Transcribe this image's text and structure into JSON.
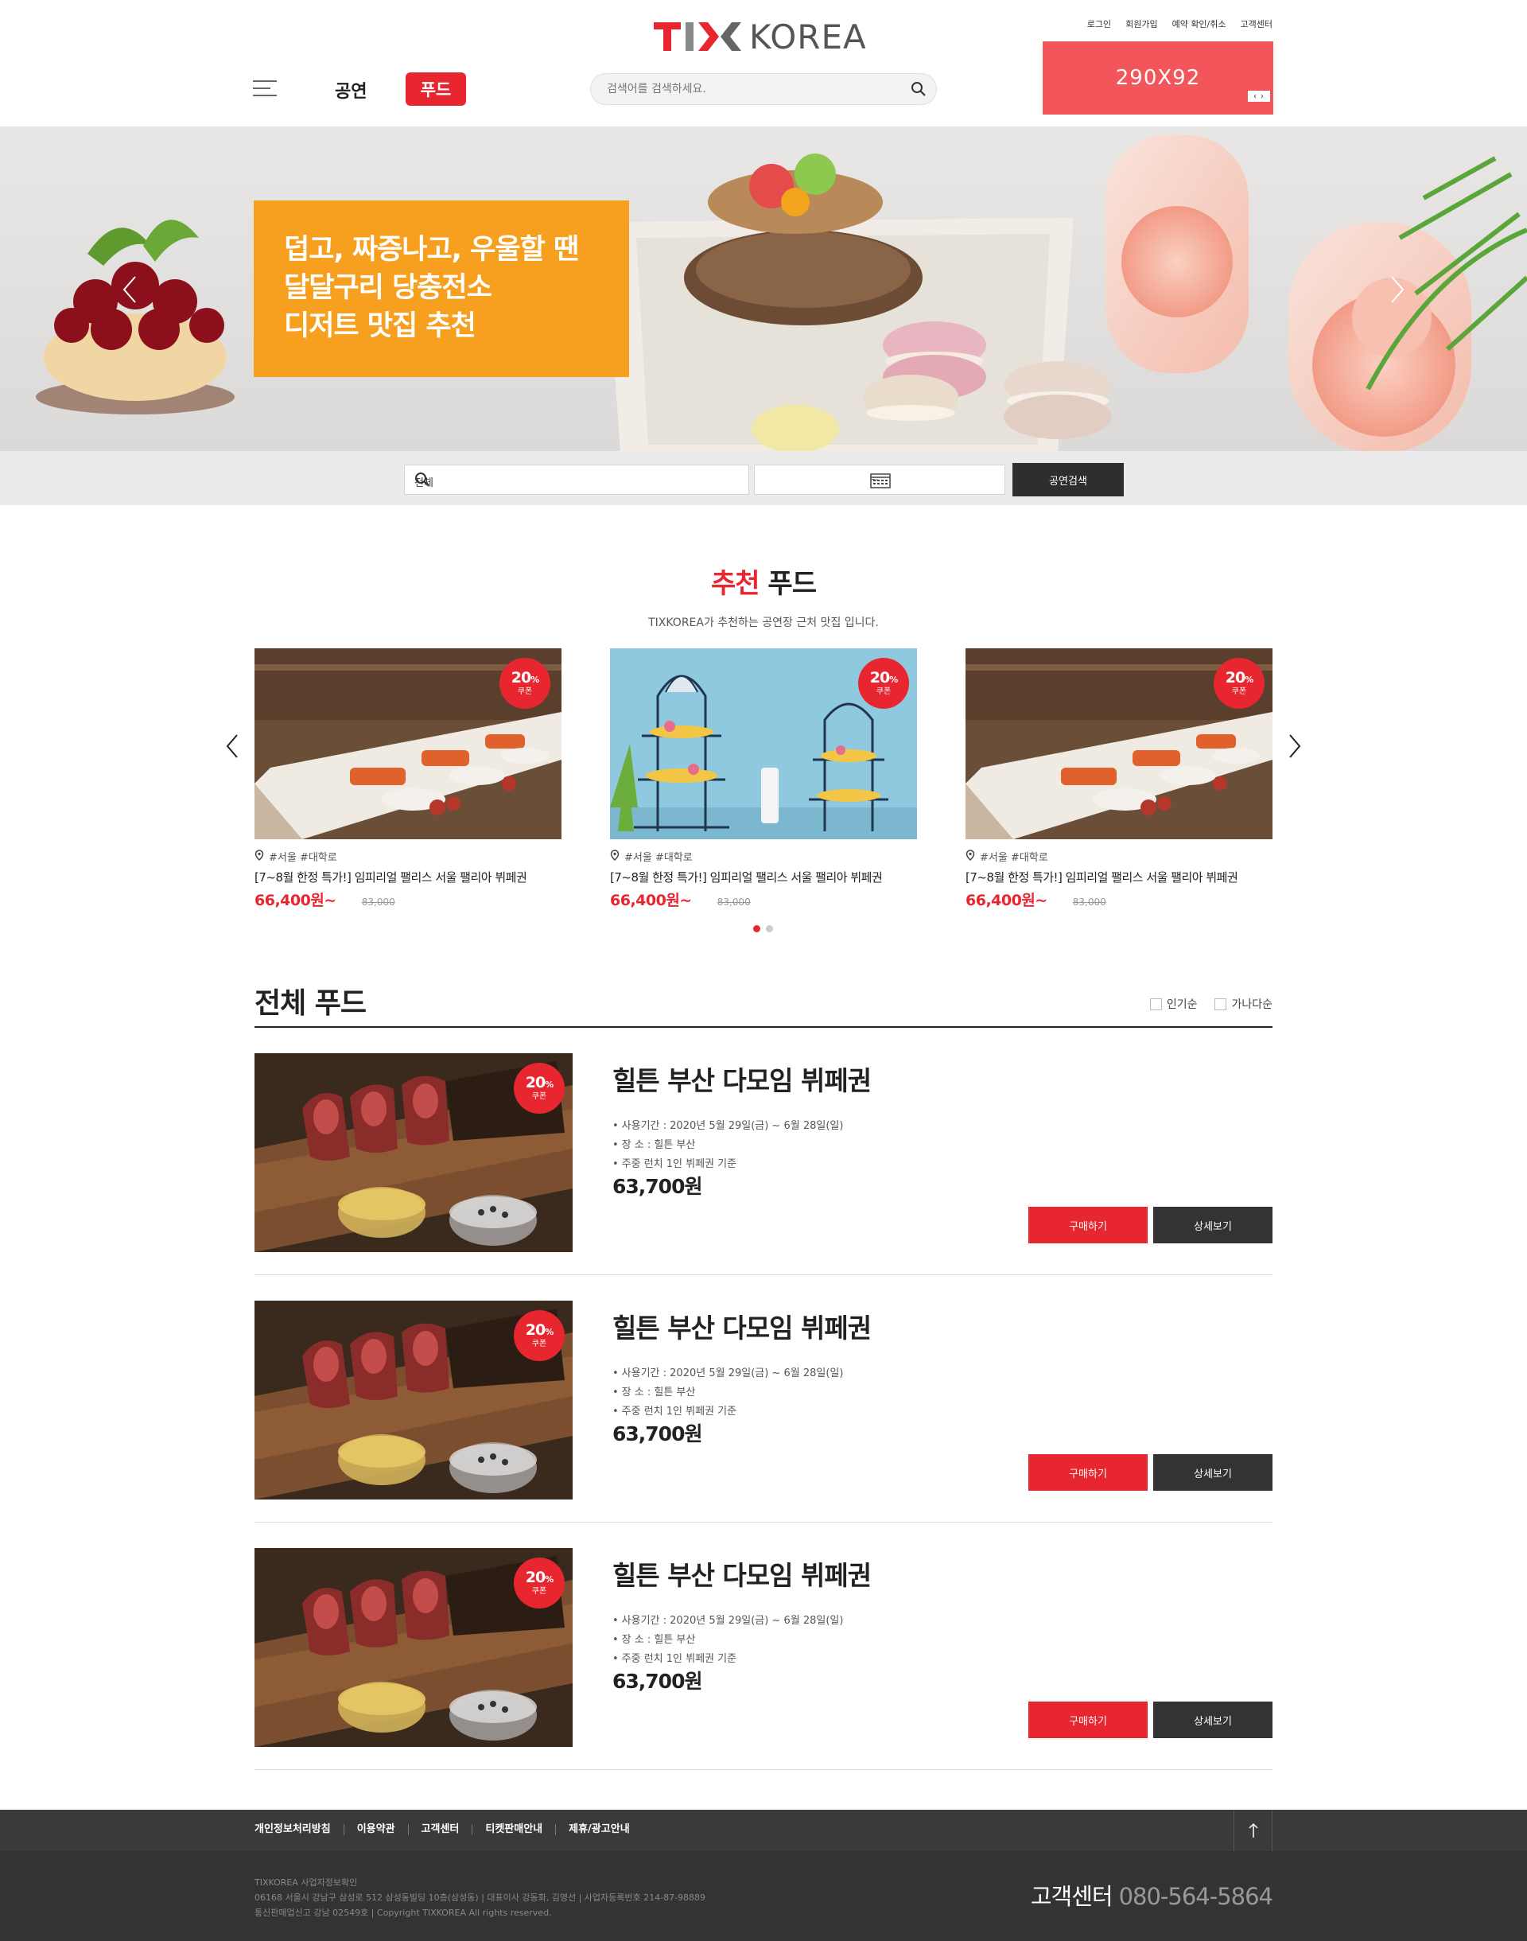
{
  "header": {
    "logo_text": "KOREA",
    "util_links": [
      "로그인",
      "회원가입",
      "예약 확인/취소",
      "고객센터"
    ],
    "ad_label": "290X92",
    "nav": {
      "performance": "공연",
      "food": "푸드"
    },
    "search_placeholder": "검색어를 검색하세요."
  },
  "hero": {
    "lines": [
      "덥고, 짜증나고, 우울할 땐",
      "달달구리 당충전소",
      "디저트 맛집 추천"
    ]
  },
  "quick_search": {
    "keyword_value": "전체",
    "date_separator": "~",
    "button_label": "공연검색"
  },
  "recommended": {
    "title_highlight": "추천",
    "title_rest": " 푸드",
    "subtitle": "TIXKOREA가 추천하는 공연장 근처 맛집 입니다.",
    "cards": [
      {
        "tags": "#서울  #대학로",
        "title": "[7~8월 한정 특가!] 임피리얼 팰리스 서울 팰리아 뷔페권",
        "price": "66,400원~",
        "original": "83,000",
        "badge_pct": "20",
        "badge_unit": "%",
        "badge_label": "쿠폰",
        "image": "buffet-photo"
      },
      {
        "tags": "#서울  #대학로",
        "title": "[7~8월 한정 특가!] 임피리얼 팰리스 서울 팰리아 뷔페권",
        "price": "66,400원~",
        "original": "83,000",
        "badge_pct": "20",
        "badge_unit": "%",
        "badge_label": "쿠폰",
        "image": "afternoon-tea-photo"
      },
      {
        "tags": "#서울  #대학로",
        "title": "[7~8월 한정 특가!] 임피리얼 팰리스 서울 팰리아 뷔페권",
        "price": "66,400원~",
        "original": "83,000",
        "badge_pct": "20",
        "badge_unit": "%",
        "badge_label": "쿠폰",
        "image": "buffet-photo"
      }
    ],
    "pages": 2,
    "active_page": 1
  },
  "all_food": {
    "title": "전체 푸드",
    "sort_options": [
      "인기순",
      "가나다순"
    ],
    "items": [
      {
        "title": "힐튼 부산 다모임 뷔페권",
        "details": [
          "사용기간 : 2020년 5월 29일(금) ~ 6월 28일(일)",
          "장 소 : 힐튼 부산",
          "주중 런치 1인 뷔페권 기준"
        ],
        "price": "63,700원",
        "buy_label": "구매하기",
        "detail_label": "상세보기",
        "badge_pct": "20",
        "badge_unit": "%",
        "badge_label": "쿠폰"
      },
      {
        "title": "힐튼 부산 다모임 뷔페권",
        "details": [
          "사용기간 : 2020년 5월 29일(금) ~ 6월 28일(일)",
          "장 소 : 힐튼 부산",
          "주중 런치 1인 뷔페권 기준"
        ],
        "price": "63,700원",
        "buy_label": "구매하기",
        "detail_label": "상세보기",
        "badge_pct": "20",
        "badge_unit": "%",
        "badge_label": "쿠폰"
      },
      {
        "title": "힐튼 부산 다모임 뷔페권",
        "details": [
          "사용기간 : 2020년 5월 29일(금) ~ 6월 28일(일)",
          "장 소 : 힐튼 부산",
          "주중 런치 1인 뷔페권 기준"
        ],
        "price": "63,700원",
        "buy_label": "구매하기",
        "detail_label": "상세보기",
        "badge_pct": "20",
        "badge_unit": "%",
        "badge_label": "쿠폰"
      }
    ]
  },
  "footer": {
    "links": [
      "개인정보처리방침",
      "이용약관",
      "고객센터",
      "티켓판매안내",
      "제휴/광고안내"
    ],
    "info_lines": [
      "TIXKOREA 사업자정보확인",
      "06168 서울시 강남구 삼성로 512 삼성동빌딩 10층(삼성동)   |   대표이사 강동화, 김영선   |   사업자등록번호 214-87-98889",
      "통신판매업신고 강남 02549호   |   Copyright TIXKOREA All rights reserved."
    ],
    "cs_label": "고객센터",
    "cs_number": "080-564-5864"
  },
  "colors": {
    "brand_red": "#e8262f",
    "hero_orange": "#f79f1f",
    "ad_red": "#f2555a",
    "dark": "#333333"
  }
}
